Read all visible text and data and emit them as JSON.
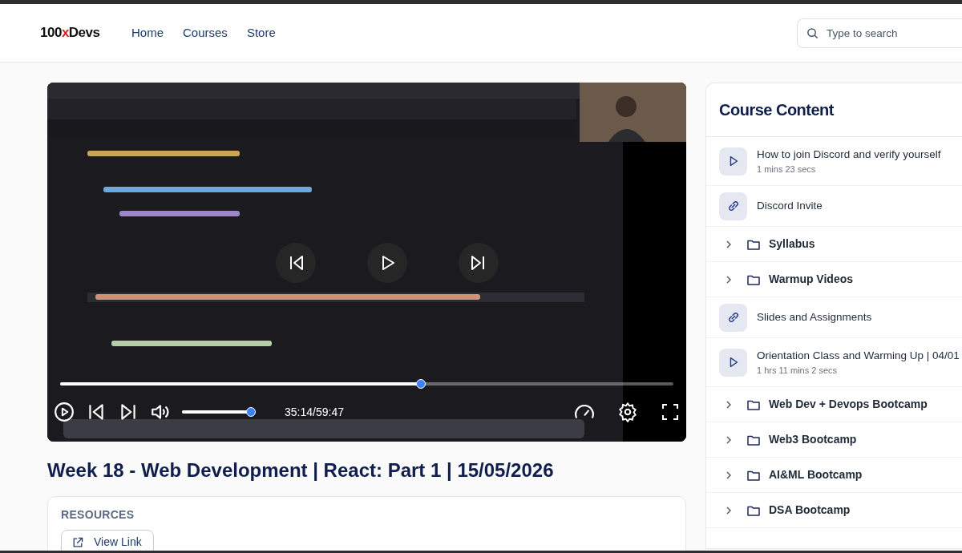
{
  "navbar": {
    "logo": {
      "prefix": "100",
      "accent": "x",
      "suffix": "Devs"
    },
    "links": [
      "Home",
      "Courses",
      "Store"
    ],
    "search": {
      "placeholder": "Type to search"
    }
  },
  "video": {
    "kind": "picture",
    "progress": {
      "level": 0.588
    },
    "volume": {
      "level": 1
    },
    "time": "35:14/59:47"
  },
  "lesson": {
    "title": "Week 18 - Web Development | React: Part 1 | 15/05/2026",
    "resources": {
      "heading": "RESOURCES",
      "link": "View Link"
    }
  },
  "course_content": {
    "title": "Course Content",
    "items": [
      {
        "kind": "video",
        "title": "How to join Discord and verify yourself",
        "duration": "1 mins 23 secs"
      },
      {
        "kind": "link",
        "title": "Discord Invite"
      },
      {
        "kind": "folder",
        "title": "Syllabus",
        "expanded": false
      },
      {
        "kind": "folder",
        "title": "Warmup Videos",
        "expanded": false
      },
      {
        "kind": "link",
        "title": "Slides and Assignments"
      },
      {
        "kind": "video",
        "title": "Orientation Class and Warming Up | 04/01",
        "duration": "1 hrs 11 mins 2 secs"
      },
      {
        "kind": "folder",
        "title": "Web Dev + Devops Bootcamp",
        "expanded": false
      },
      {
        "kind": "folder",
        "title": "Web3 Bootcamp",
        "expanded": false
      },
      {
        "kind": "folder",
        "title": "AI&ML Bootcamp",
        "expanded": false
      },
      {
        "kind": "folder",
        "title": "DSA Bootcamp",
        "expanded": false
      }
    ]
  }
}
